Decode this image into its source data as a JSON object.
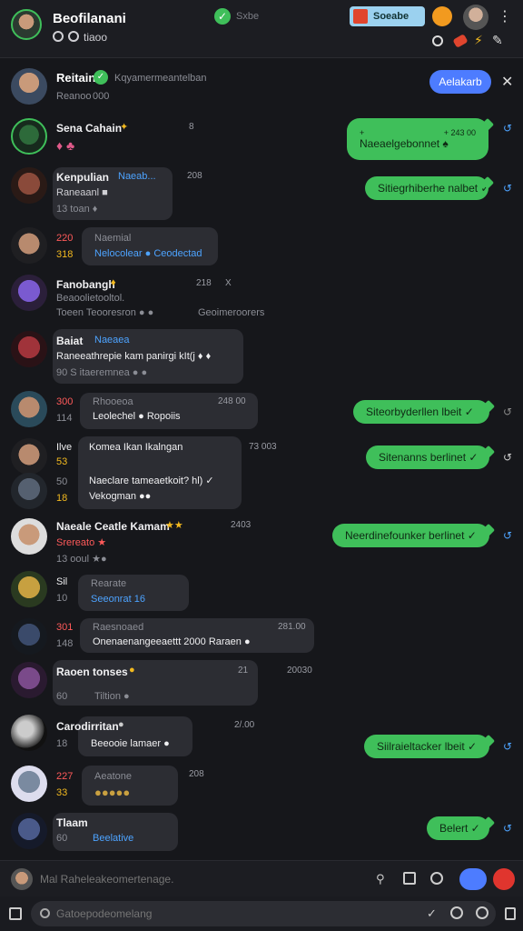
{
  "header": {
    "title": "Beofilanani",
    "subtitle": "tiaoo",
    "status_text": "Sxbe",
    "search_chip": "Soeabe",
    "icons": [
      "settings-icon",
      "check-icon",
      "logo-icon",
      "avatar",
      "search-icon",
      "tag-icon",
      "bolt-icon",
      "more-icon"
    ]
  },
  "contact_banner": {
    "name": "Reitain",
    "sub": "Kqyamermeantelban",
    "sub2": "Reanoo",
    "sub2_time": "000",
    "button": "Aelakarb"
  },
  "rows": [
    {
      "name": "Sena Cahain",
      "emoji": "✦",
      "sub": "♦ ♣",
      "time": "8",
      "out": "Naeaelgebonnet ♠",
      "out_time": "+ 243 00",
      "out_top": "+"
    },
    {
      "name": "Kenpulian",
      "tag": "Naeab...",
      "sub": "Raneaanl ■",
      "meta": "13   toan ♦",
      "time": "208",
      "out": "Sitiegrhiberhe nalbet ✓"
    },
    {
      "name": "Naemial",
      "sub": "Nelocolear ● Ceodectad",
      "num1": "220",
      "num2": "318"
    },
    {
      "name": "Fanobangh",
      "emoji": "♦",
      "sub": "Beaoolietooltol.",
      "meta": "Toeen  Teooresron ● ●",
      "side": "Geoimeroorers",
      "time": "218",
      "time2": "X"
    },
    {
      "name": "Baiat",
      "tag": "Naeaea",
      "sub": "Raneeathrepie kam panirgi kIt(j ♦ ♦",
      "meta": "90 S itaeremnea ● ●"
    },
    {
      "name": "Rhooeoa",
      "sub": "Leolechel ● Ropoiis",
      "num1": "300",
      "num2": "114",
      "time": "248 00",
      "out": "Siteorbyderllen lbeit ✓"
    },
    {
      "name": "Ilve",
      "bubble_title": "Komea Ikan Ikalngan",
      "sub": "Naeclare tameaetkoit? hl) ✓",
      "meta": "Vekogman ●●",
      "num1": "53",
      "num2": "50",
      "num3": "18",
      "time": "73 003",
      "out": "Sitenanns berlinet ✓"
    },
    {
      "name": "Naeale Ceatle Kamam",
      "emoji": "★★",
      "sub": "Srereato ★",
      "meta": "13   ooul ★●",
      "time": "2403",
      "out": "Neerdinefounker berlinet ✓"
    },
    {
      "name": "Sil",
      "sub": "Rearate",
      "meta2": "Seeonrat 16",
      "num1": "10"
    },
    {
      "name": "Raesnoaed",
      "sub": "Onenaenangeeaettt 2000 Raraen ●",
      "num1": "301",
      "num2": "148",
      "time": "281.00"
    },
    {
      "name": "Raoen tonses",
      "emoji": "●",
      "sub": "Tiltion ●",
      "meta": "60",
      "time": "21",
      "time2": "20030"
    },
    {
      "name": "Carodirritan",
      "emoji": "●",
      "sub": "Beeooie lamaer ●",
      "num1": "18",
      "time": "2/.00",
      "out": "Siilraieltacker lbeit ✓"
    },
    {
      "name": "Aeatone",
      "sub": "●●●●●",
      "num1": "227",
      "num2": "33",
      "time": "208"
    },
    {
      "name": "Tlaam",
      "sub": "Beelative",
      "num1": "60",
      "out": "Belert ✓"
    }
  ],
  "composer": {
    "placeholder": "Mal Raheleakeomertenage.",
    "search_placeholder": "Gatoepodeomelang"
  },
  "colors": {
    "bg": "#16171b",
    "bubble_in": "#2c2d33",
    "bubble_out": "#3fbf5a",
    "accent": "#4d7cff",
    "link": "#4da3ff"
  }
}
